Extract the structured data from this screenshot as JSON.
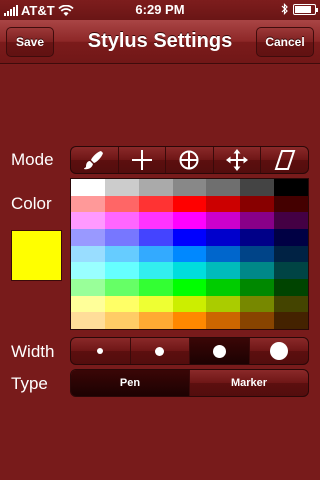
{
  "status_bar": {
    "carrier": "AT&T",
    "time": "6:29 PM",
    "wifi_icon": "wifi-icon",
    "bluetooth_icon": "bluetooth-icon",
    "battery_level": 0.85
  },
  "nav": {
    "title": "Stylus Settings",
    "save_label": "Save",
    "cancel_label": "Cancel"
  },
  "mode": {
    "label": "Mode",
    "options": [
      "brush-icon",
      "crosshair-icon",
      "target-icon",
      "move-arrows-icon",
      "eraser-icon"
    ],
    "selected": 1
  },
  "color": {
    "label": "Color",
    "selected_color": "#ffff00",
    "palette": [
      [
        "#ffffff",
        "#cccccc",
        "#aaaaaa",
        "#888888",
        "#6f6f6f",
        "#444444",
        "#000000"
      ],
      [
        "#ff9999",
        "#ff6666",
        "#ff3333",
        "#ff0000",
        "#cc0000",
        "#880000",
        "#440000"
      ],
      [
        "#ff99ff",
        "#ff66ff",
        "#ff33ff",
        "#ff00ff",
        "#cc00cc",
        "#880088",
        "#440044"
      ],
      [
        "#9999ff",
        "#7777ff",
        "#4444ff",
        "#0000ff",
        "#0000cc",
        "#000088",
        "#000044"
      ],
      [
        "#99ddff",
        "#66ccff",
        "#33aaff",
        "#0088ff",
        "#0066cc",
        "#004488",
        "#002244"
      ],
      [
        "#99ffff",
        "#66ffff",
        "#33eeee",
        "#00dddd",
        "#00bbbb",
        "#008888",
        "#004444"
      ],
      [
        "#99ff99",
        "#66ff66",
        "#33ff33",
        "#00ff00",
        "#00cc00",
        "#008800",
        "#004400"
      ],
      [
        "#ffff99",
        "#ffff66",
        "#eeff33",
        "#ccee00",
        "#aacc00",
        "#778800",
        "#444400"
      ],
      [
        "#ffdd99",
        "#ffcc66",
        "#ffaa33",
        "#ff8800",
        "#cc6600",
        "#884400",
        "#442200"
      ]
    ]
  },
  "width": {
    "label": "Width",
    "options": [
      1,
      2,
      3,
      4
    ],
    "selected": 2
  },
  "type": {
    "label": "Type",
    "options": [
      "Pen",
      "Marker"
    ],
    "selected": 0
  }
}
